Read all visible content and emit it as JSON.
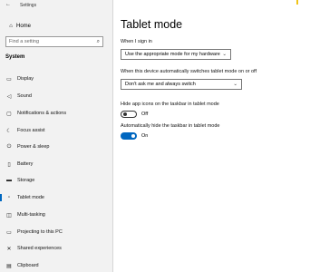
{
  "window": {
    "title": "Settings"
  },
  "sidebar": {
    "home_label": "Home",
    "search_placeholder": "Find a setting",
    "section_label": "System",
    "items": [
      {
        "label": "Display",
        "icon": "monitor-icon"
      },
      {
        "label": "Sound",
        "icon": "speaker-icon"
      },
      {
        "label": "Notifications & actions",
        "icon": "notifications-icon"
      },
      {
        "label": "Focus assist",
        "icon": "moon-icon"
      },
      {
        "label": "Power & sleep",
        "icon": "power-icon"
      },
      {
        "label": "Battery",
        "icon": "battery-icon"
      },
      {
        "label": "Storage",
        "icon": "storage-icon"
      },
      {
        "label": "Tablet mode",
        "icon": "tablet-icon",
        "active": true
      },
      {
        "label": "Multi-tasking",
        "icon": "multitasking-icon"
      },
      {
        "label": "Projecting to this PC",
        "icon": "projecting-icon"
      },
      {
        "label": "Shared experiences",
        "icon": "shared-experiences-icon"
      },
      {
        "label": "Clipboard",
        "icon": "clipboard-icon"
      }
    ]
  },
  "main": {
    "title": "Tablet mode",
    "signin_label": "When I sign in",
    "signin_value": "Use the appropriate mode for my hardware",
    "switch_label": "When this device automatically switches tablet mode on or off",
    "switch_value": "Don't ask me and always switch",
    "hide_icons_label": "Hide app icons on the taskbar in tablet mode",
    "hide_icons_state": "Off",
    "auto_hide_label": "Automatically hide the taskbar in tablet mode",
    "auto_hide_state": "On"
  },
  "colors": {
    "accent": "#0067c0",
    "sidebar_bg": "#f2f2f2"
  }
}
